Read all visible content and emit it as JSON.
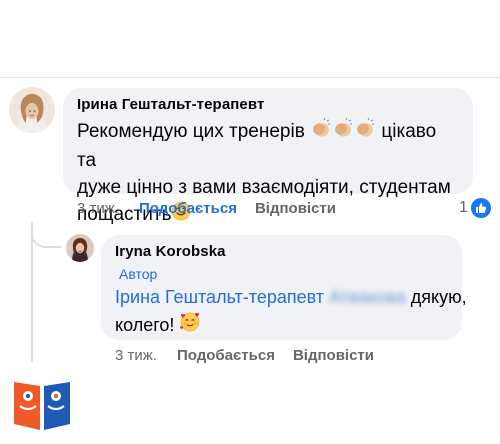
{
  "comment1": {
    "author": "Ірина Гештальт-терапевт",
    "text_part1": "Рекомендую цих тренерів",
    "text_part2": "цікаво та",
    "text_line2": "дуже цінно з вами взаємодіяти, студентам",
    "text_line3": "пощастить",
    "emojis": [
      "clapping-hands-emoji",
      "clapping-hands-emoji",
      "clapping-hands-emoji",
      "smiling-face-emoji"
    ],
    "time": "3 тиж.",
    "like_label": "Подобається",
    "reply_label": "Відповісти",
    "reaction_count": "1"
  },
  "comment2": {
    "author": "Iryna  Korobska",
    "badge": "Автор",
    "mention": "Ірина Гештальт-терапевт",
    "text_part1": "дякую,",
    "text_line2": "колего!",
    "emojis": [
      "smiling-face-with-hearts-emoji"
    ],
    "time": "3 тиж.",
    "like_label": "Подобається",
    "reply_label": "Відповісти"
  },
  "colors": {
    "link_blue": "#216fdb",
    "bubble_bg": "#f0f2f5",
    "meta_gray": "#65676b",
    "like_blue": "#1877f2",
    "logo_orange": "#f05a28",
    "logo_blue": "#1f5bb5"
  }
}
